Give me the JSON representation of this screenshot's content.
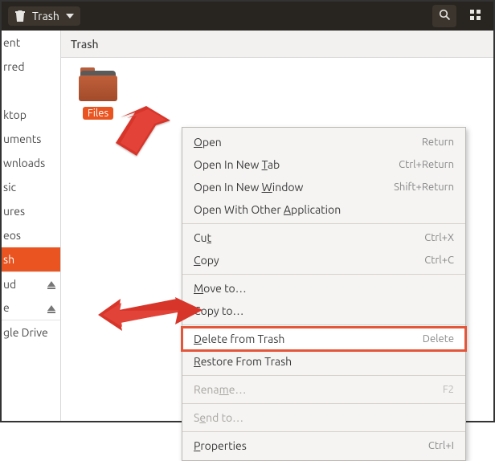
{
  "titlebar": {
    "crumb_label": "Trash"
  },
  "sidebar": {
    "items": [
      {
        "label": "ent",
        "sep": false,
        "eject": false
      },
      {
        "label": "rred",
        "sep": false,
        "eject": false
      },
      {
        "label": "",
        "sep": false,
        "eject": false
      },
      {
        "label": "ktop",
        "sep": false,
        "eject": false
      },
      {
        "label": "uments",
        "sep": false,
        "eject": false
      },
      {
        "label": "wnloads",
        "sep": false,
        "eject": false
      },
      {
        "label": "sic",
        "sep": false,
        "eject": false
      },
      {
        "label": "ures",
        "sep": false,
        "eject": false
      },
      {
        "label": "eos",
        "sep": false,
        "eject": false
      },
      {
        "label": "sh",
        "sep": false,
        "eject": false,
        "active": true
      },
      {
        "label": "ud",
        "sep": true,
        "eject": true
      },
      {
        "label": "e",
        "sep": false,
        "eject": true
      },
      {
        "label": "gle Drive",
        "sep": true,
        "eject": false
      }
    ]
  },
  "content": {
    "header_title": "Trash",
    "folder_label": "Files"
  },
  "menu": {
    "open": {
      "label_pre": "",
      "label_u": "O",
      "label_post": "pen",
      "shortcut": "Return"
    },
    "open_tab": {
      "label_pre": "Open In New ",
      "label_u": "T",
      "label_post": "ab",
      "shortcut": "Ctrl+Return"
    },
    "open_win": {
      "label_pre": "Open In New ",
      "label_u": "W",
      "label_post": "indow",
      "shortcut": "Shift+Return"
    },
    "open_with": {
      "label_pre": "Open With Other ",
      "label_u": "A",
      "label_post": "pplication",
      "shortcut": ""
    },
    "cut": {
      "label_pre": "Cu",
      "label_u": "t",
      "label_post": "",
      "shortcut": "Ctrl+X"
    },
    "copy": {
      "label_pre": "",
      "label_u": "C",
      "label_post": "opy",
      "shortcut": "Ctrl+C"
    },
    "move_to": {
      "label_pre": "",
      "label_u": "M",
      "label_post": "ove to…",
      "shortcut": ""
    },
    "copy_to": {
      "label_pre": "Copy to…",
      "label_u": "",
      "label_post": "",
      "shortcut": ""
    },
    "delete": {
      "label_pre": "",
      "label_u": "D",
      "label_post": "elete from Trash",
      "shortcut": "Delete"
    },
    "restore": {
      "label_pre": "",
      "label_u": "R",
      "label_post": "estore From Trash",
      "shortcut": ""
    },
    "rename": {
      "label_pre": "Rena",
      "label_u": "m",
      "label_post": "e…",
      "shortcut": "F2"
    },
    "send_to": {
      "label_pre": "S",
      "label_u": "e",
      "label_post": "nd to…",
      "shortcut": ""
    },
    "properties": {
      "label_pre": "",
      "label_u": "P",
      "label_post": "roperties",
      "shortcut": "Ctrl+I"
    }
  }
}
